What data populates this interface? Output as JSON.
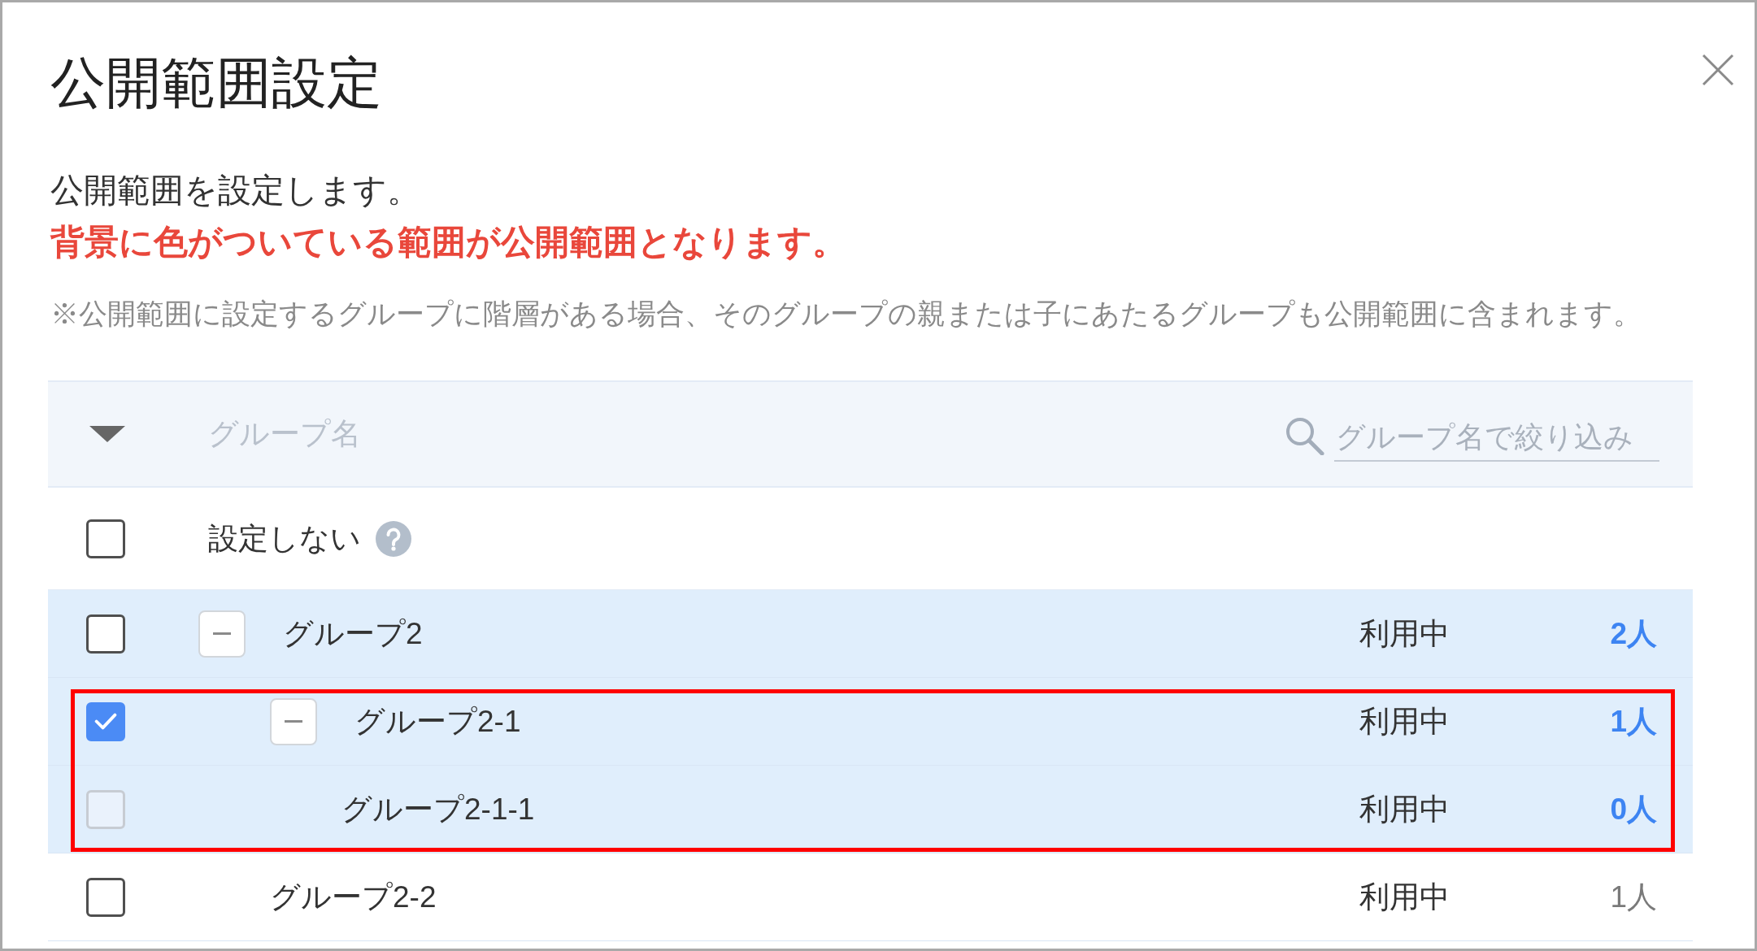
{
  "dialog": {
    "title": "公開範囲設定"
  },
  "intro": "公開範囲を設定します。",
  "warning": "背景に色がついている範囲が公開範囲となります。",
  "note": "※公開範囲に設定するグループに階層がある場合、そのグループの親または子にあたるグループも公開範囲に含まれます。",
  "table": {
    "column_label": "グループ名",
    "search": {
      "placeholder": "グループ名で絞り込み"
    },
    "none_option": {
      "label": "設定しない",
      "checked": false
    },
    "groups": [
      {
        "name": "グループ2",
        "status": "利用中",
        "count": "2人",
        "checked": false,
        "disabled": false,
        "in_scope": true,
        "highlighted": false,
        "expanded": true,
        "children": [
          {
            "name": "グループ2-1",
            "status": "利用中",
            "count": "1人",
            "checked": true,
            "disabled": false,
            "in_scope": true,
            "highlighted": true,
            "expanded": true,
            "children": [
              {
                "name": "グループ2-1-1",
                "status": "利用中",
                "count": "0人",
                "checked": false,
                "disabled": true,
                "in_scope": true,
                "highlighted": false
              }
            ]
          },
          {
            "name": "グループ2-2",
            "status": "利用中",
            "count": "1人",
            "checked": false,
            "disabled": false,
            "in_scope": false,
            "highlighted": false
          }
        ]
      }
    ]
  }
}
